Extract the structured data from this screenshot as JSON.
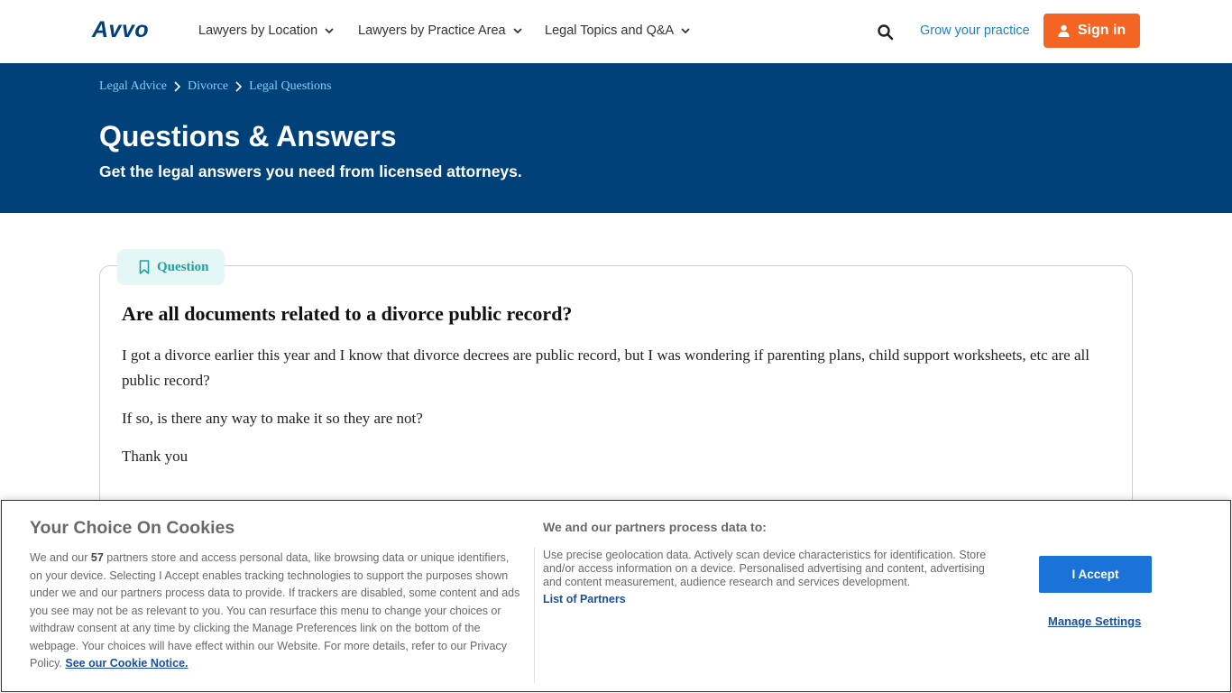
{
  "header": {
    "logo": "Avvo",
    "nav": [
      {
        "label": "Lawyers by Location"
      },
      {
        "label": "Lawyers by Practice Area"
      },
      {
        "label": "Legal Topics and Q&A"
      }
    ],
    "grow_link": "Grow your practice",
    "signin_label": "Sign in"
  },
  "hero": {
    "breadcrumbs": [
      "Legal Advice",
      "Divorce",
      "Legal Questions"
    ],
    "title": "Questions & Answers",
    "subtitle": "Get the legal answers you need from licensed attorneys."
  },
  "question": {
    "tag": "Question",
    "title": "Are all documents related to a divorce public record?",
    "body": [
      "I got a divorce earlier this year and I know that divorce decrees are public record, but I was wondering if parenting plans, child support worksheets, etc are all public record?",
      "If so, is there any way to make it so they are not?",
      "Thank you"
    ]
  },
  "cookie": {
    "title": "Your Choice On Cookies",
    "text_before_count": "We and our ",
    "partner_count": "57",
    "text_after_count": " partners store and access personal data, like browsing data or unique identifiers, on your device. Selecting I Accept enables tracking technologies to support the purposes shown under we and our partners process data to provide. If trackers are disabled, some content and ads you see may not be as relevant to you. You can resurface this menu to change your choices or withdraw consent at any time by clicking the Manage Preferences link on the bottom of the webpage. Your choices will have effect within our Website. For more details, refer to our Privacy Policy. ",
    "notice_link": "See our Cookie Notice.",
    "right_title": "We and our partners process data to:",
    "right_text": "Use precise geolocation data. Actively scan device characteristics for identification. Store and/or access information on a device. Personalised advertising and content, advertising and content measurement, audience research and services development.",
    "partners_link": "List of Partners",
    "accept_label": "I Accept",
    "manage_label": "Manage Settings"
  },
  "colors": {
    "brand_blue": "#00417a",
    "signin_orange": "#f46524",
    "link_blue": "#1a84c7",
    "question_teal": "#1aa5a0",
    "accept_blue": "#1a73d9"
  },
  "icons": {
    "search": "search-icon",
    "user": "user-icon",
    "chevron": "chevron-down-icon",
    "bookmark": "bookmark-icon",
    "crumb_sep": "chevron-right-icon"
  }
}
